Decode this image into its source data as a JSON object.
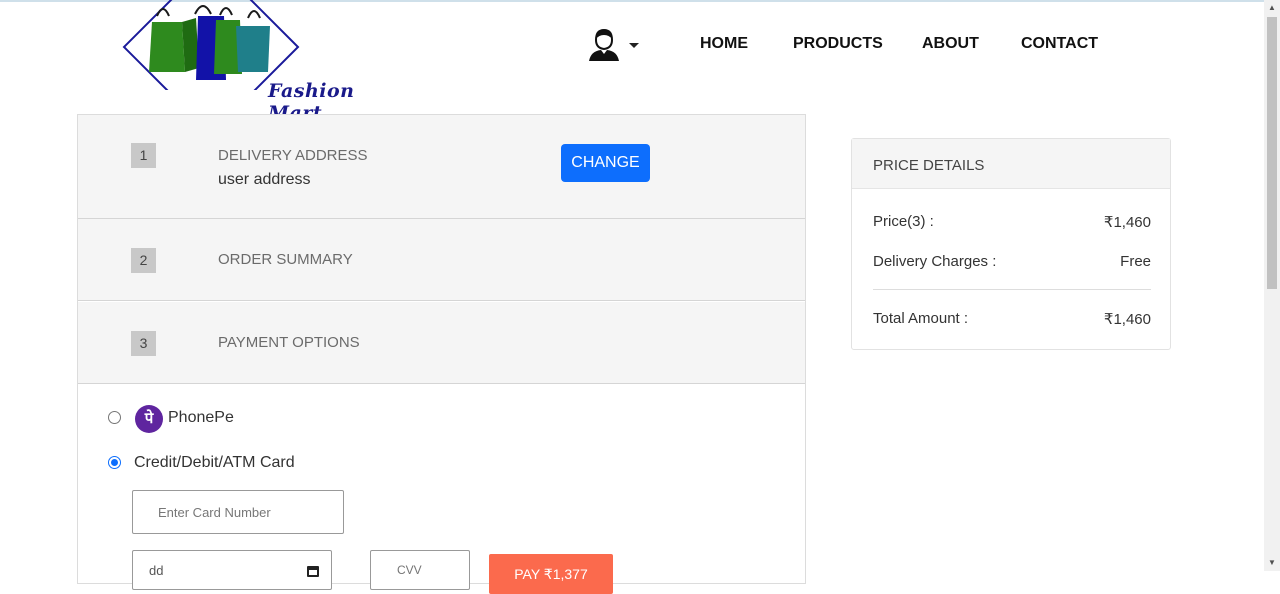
{
  "brand": {
    "name": "Fashion Mart"
  },
  "nav": {
    "home": "HOME",
    "products": "PRODUCTS",
    "about": "ABOUT",
    "contact": "CONTACT"
  },
  "steps": [
    {
      "number": "1",
      "title": "DELIVERY ADDRESS",
      "subtitle": "user address",
      "action": "CHANGE"
    },
    {
      "number": "2",
      "title": "ORDER SUMMARY"
    },
    {
      "number": "3",
      "title": "PAYMENT OPTIONS"
    }
  ],
  "payment": {
    "options": [
      {
        "label": "PhonePe",
        "logo_glyph": "पे",
        "selected": false
      },
      {
        "label": "Credit/Debit/ATM Card",
        "selected": true
      }
    ],
    "card_number_placeholder": "Enter Card Number",
    "expiry_placeholder": "dd",
    "cvv_placeholder": "CVV",
    "pay_button": "PAY ₹1,377"
  },
  "price_details": {
    "heading": "PRICE DETAILS",
    "price_label": "Price(3) :",
    "price_value": "₹1,460",
    "delivery_label": "Delivery Charges :",
    "delivery_value": "Free",
    "total_label": "Total Amount :",
    "total_value": "₹1,460"
  },
  "colors": {
    "primary": "#0d6efd",
    "pay": "#fb6a4d",
    "phonepe": "#5f259f"
  }
}
